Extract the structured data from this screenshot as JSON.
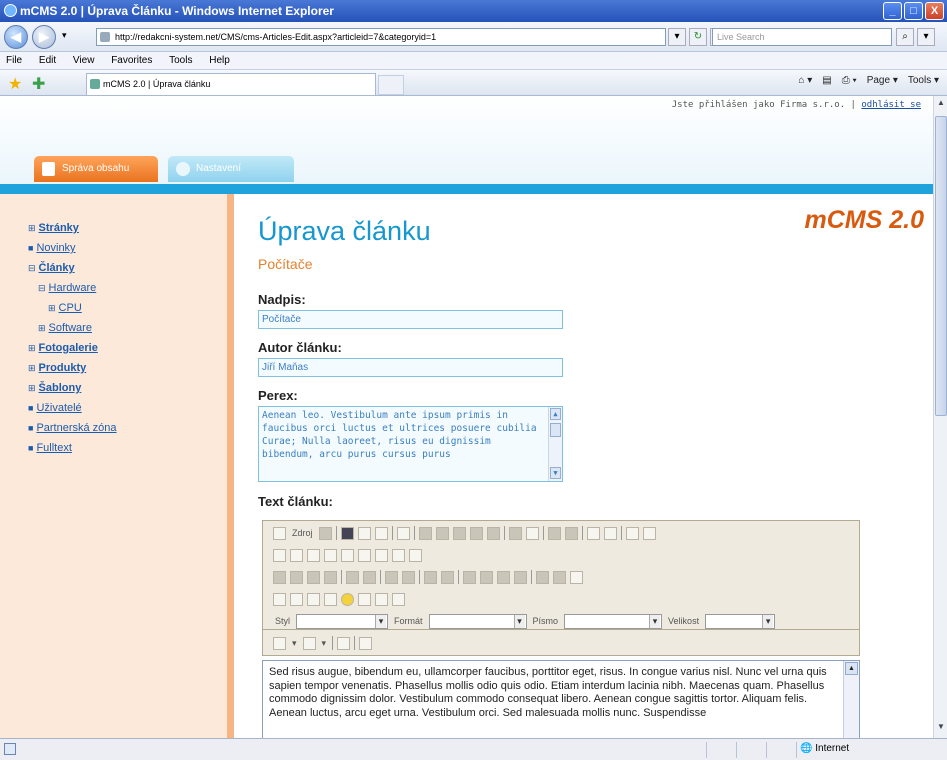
{
  "window": {
    "title": "mCMS 2.0 | Úprava Článku - Windows Internet Explorer",
    "controls": [
      "_",
      "□",
      "X"
    ]
  },
  "address": {
    "url": "http://redakcni-system.net/CMS/cms-Articles-Edit.aspx?articleid=7&categoryid=1",
    "search_placeholder": "Live Search"
  },
  "menu": [
    "File",
    "Edit",
    "View",
    "Favorites",
    "Tools",
    "Help"
  ],
  "tab": {
    "label": "mCMS 2.0 | Úprava článku"
  },
  "commands": {
    "page": "Page ▾",
    "tools": "Tools ▾"
  },
  "site": {
    "login_text": "Jste přihlášen jako Firma s.r.o. |",
    "logout_label": "odhlásit se",
    "tabs": [
      "Správa obsahu",
      "Nastavení"
    ],
    "logo": "mCMS 2.0"
  },
  "nav": [
    {
      "label": "Stránky",
      "bullet": "⊞",
      "bold": true,
      "level": 0
    },
    {
      "label": "Novinky",
      "bullet": "■",
      "bold": false,
      "level": 0
    },
    {
      "label": "Články",
      "bullet": "⊟",
      "bold": true,
      "level": 0
    },
    {
      "label": "Hardware",
      "bullet": "⊟",
      "bold": false,
      "level": 1
    },
    {
      "label": "CPU",
      "bullet": "⊞",
      "bold": false,
      "level": 2
    },
    {
      "label": "Software",
      "bullet": "⊞",
      "bold": false,
      "level": 1
    },
    {
      "label": "Fotogalerie",
      "bullet": "⊞",
      "bold": true,
      "level": 0
    },
    {
      "label": "Produkty",
      "bullet": "⊞",
      "bold": true,
      "level": 0
    },
    {
      "label": "Šablony",
      "bullet": "⊞",
      "bold": true,
      "level": 0
    },
    {
      "label": "Uživatelé",
      "bullet": "■",
      "bold": false,
      "level": 0
    },
    {
      "label": "Partnerská zóna",
      "bullet": "■",
      "bold": false,
      "level": 0
    },
    {
      "label": "Fulltext",
      "bullet": "■",
      "bold": false,
      "level": 0
    }
  ],
  "page": {
    "title": "Úprava článku",
    "category": "Počítače",
    "nadpis_label": "Nadpis:",
    "nadpis_value": "Počítače",
    "autor_label": "Autor článku:",
    "autor_value": "Jiří Maňas",
    "perex_label": "Perex:",
    "perex_value": "Aenean leo. Vestibulum ante ipsum primis in faucibus orci luctus et ultrices posuere cubilia Curae; Nulla laoreet, risus eu dignissim bibendum, arcu purus cursus purus",
    "text_label": "Text článku:"
  },
  "editor": {
    "source_label": "Zdroj",
    "style_label": "Styl",
    "format_label": "Formát",
    "font_label": "Písmo",
    "size_label": "Velikost",
    "body": "Sed risus augue, bibendum eu, ullamcorper faucibus, porttitor eget, risus. In congue varius nisl. Nunc vel urna quis sapien tempor venenatis. Phasellus mollis odio quis odio. Etiam interdum lacinia nibh. Maecenas quam. Phasellus commodo dignissim dolor. Vestibulum commodo consequat libero. Aenean congue sagittis tortor. Aliquam felis. Aenean luctus, arcu eget urna. Vestibulum orci. Sed malesuada mollis nunc. Suspendisse"
  },
  "status": {
    "zone": "Internet"
  }
}
